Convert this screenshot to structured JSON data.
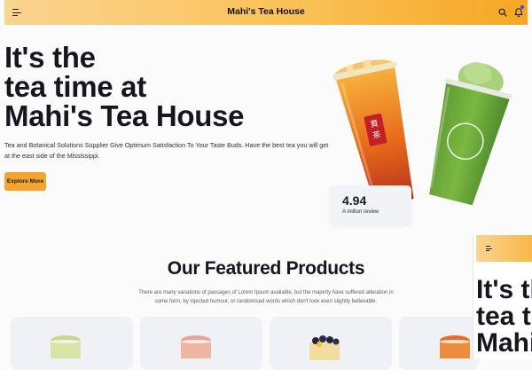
{
  "header": {
    "brand": "Mahi's Tea House",
    "menu_icon": "hamburger-menu-icon",
    "search_icon": "search-icon",
    "notification_icon": "bell-icon",
    "accent_color": "#f6a623",
    "notification_dot_color": "#3b49d8"
  },
  "hero": {
    "title_lines": [
      "It's the",
      "tea time at",
      "Mahi's Tea House"
    ],
    "description": "Tea and Botanical Solutions Supplier Give Optimum Satisfaction To Your Taste Buds. Have the best tea you will get at the east side of the Mississippi.",
    "cta_label": "Explore More"
  },
  "rating_card": {
    "value": "4.94",
    "label": "A million review"
  },
  "featured": {
    "title": "Our Featured Products",
    "description": "There are many variations of passages of Lorem Ipsum available, but the majority have suffered alteration in some form, by injected humour, or randomised words which don't look even slightly believable."
  },
  "mini_preview": {
    "title_lines": [
      "It's th",
      "tea tim",
      "Mahi's"
    ]
  }
}
